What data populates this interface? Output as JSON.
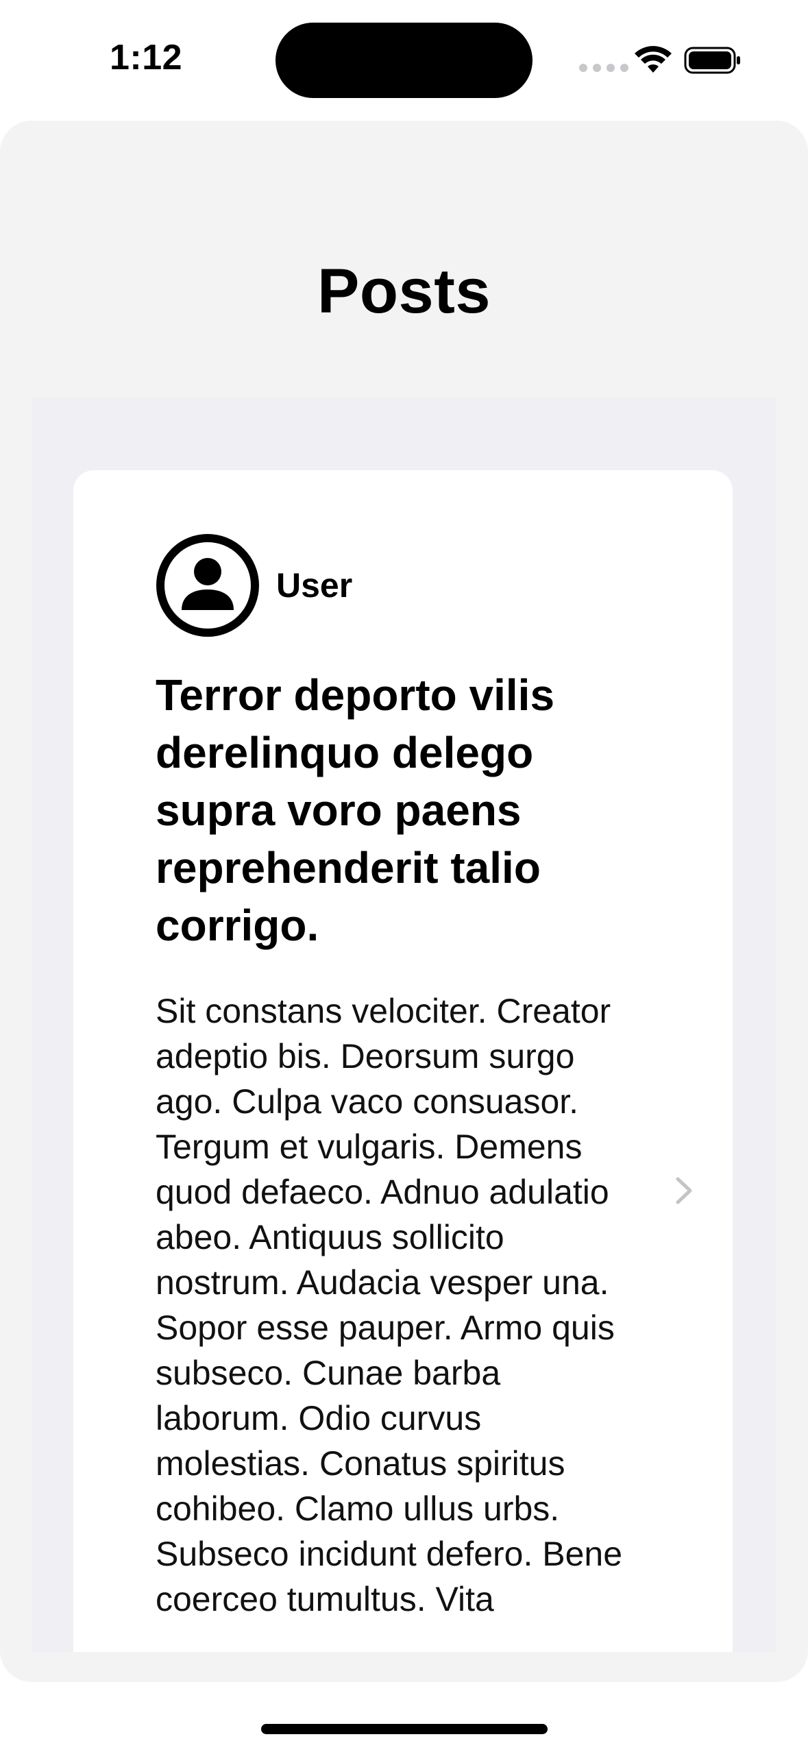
{
  "status_bar": {
    "time": "1:12",
    "icons": [
      "cellular-dots-icon",
      "wifi-icon",
      "battery-icon"
    ]
  },
  "header": {
    "title": "Posts"
  },
  "post": {
    "author": "User",
    "avatar_icon": "person-circle-icon",
    "title": "Terror deporto vilis derelinquo delego supra voro paens reprehenderit talio corrigo.",
    "body": "Sit constans velociter. Creator adeptio bis. Deorsum surgo ago. Culpa vaco consuasor. Tergum et vulgaris. Demens quod defaeco. Adnuo adulatio abeo. Antiquus sollicito nostrum. Audacia vesper una. Sopor esse pauper. Armo quis subseco. Cunae barba laborum. Odio curvus molestias. Conatus spiritus cohibeo. Clamo ullus urbs. Subseco incidunt defero. Bene coerceo tumultus. Vita",
    "disclosure_icon": "chevron-right-icon"
  },
  "colors": {
    "sheet_background": "#f3f3f4",
    "list_background": "#efeff4",
    "card_background": "#ffffff",
    "chevron": "#c4c4c7"
  }
}
